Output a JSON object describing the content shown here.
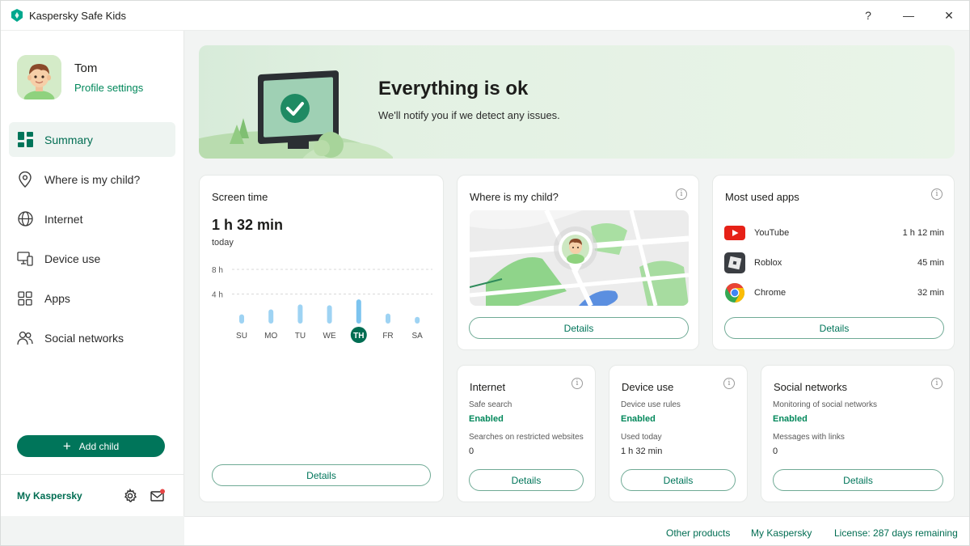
{
  "window": {
    "title": "Kaspersky Safe Kids",
    "help": "?",
    "minimize": "—",
    "close": "✕"
  },
  "profile": {
    "name": "Tom",
    "settings_link": "Profile settings"
  },
  "sidebar": {
    "items": [
      {
        "label": "Summary",
        "icon": "summary-grid-icon"
      },
      {
        "label": "Where is my child?",
        "icon": "location-pin-icon"
      },
      {
        "label": "Internet",
        "icon": "globe-icon"
      },
      {
        "label": "Device use",
        "icon": "devices-icon"
      },
      {
        "label": "Apps",
        "icon": "apps-grid-icon"
      },
      {
        "label": "Social networks",
        "icon": "people-icon"
      }
    ],
    "add_child": "Add child",
    "my_kaspersky": "My Kaspersky"
  },
  "banner": {
    "title": "Everything is ok",
    "subtitle": "We'll notify you if we detect any issues."
  },
  "screen_time": {
    "title": "Screen time",
    "value": "1 h 32 min",
    "sub": "today",
    "details": "Details",
    "chart_data": {
      "type": "bar",
      "categories": [
        "SU",
        "MO",
        "TU",
        "WE",
        "TH",
        "FR",
        "SA"
      ],
      "values": [
        1.1,
        1.7,
        2.3,
        2.2,
        2.9,
        1.2,
        0.8
      ],
      "highlight": "TH",
      "ytick_labels": [
        "8 h",
        "4 h"
      ],
      "yticks": [
        8,
        4
      ],
      "ylim": [
        0,
        8
      ],
      "grid": true,
      "bar_color": "#9ed3f3",
      "highlight_bar_color": "#7cc4ef",
      "highlight_label_color": "#006d52"
    }
  },
  "location": {
    "title": "Where is my child?",
    "details": "Details"
  },
  "apps": {
    "title": "Most used apps",
    "details": "Details",
    "items": [
      {
        "name": "YouTube",
        "time": "1 h 12 min",
        "icon": "youtube-icon"
      },
      {
        "name": "Roblox",
        "time": "45 min",
        "icon": "roblox-icon"
      },
      {
        "name": "Chrome",
        "time": "32 min",
        "icon": "chrome-icon"
      }
    ]
  },
  "internet": {
    "title": "Internet",
    "label1": "Safe search",
    "status1": "Enabled",
    "label2": "Searches on restricted websites",
    "value2": "0",
    "details": "Details"
  },
  "device_use": {
    "title": "Device use",
    "label1": "Device use rules",
    "status1": "Enabled",
    "label2": "Used today",
    "value2": "1 h 32 min",
    "details": "Details"
  },
  "social": {
    "title": "Social networks",
    "label1": "Monitoring of social networks",
    "status1": "Enabled",
    "label2": "Messages with links",
    "value2": "0",
    "details": "Details"
  },
  "footer": {
    "other_products": "Other products",
    "my_kaspersky": "My Kaspersky",
    "license": "License: 287 days remaining"
  },
  "colors": {
    "accent": "#00755a",
    "accent_text": "#00875a",
    "background": "#f2f4f3"
  }
}
